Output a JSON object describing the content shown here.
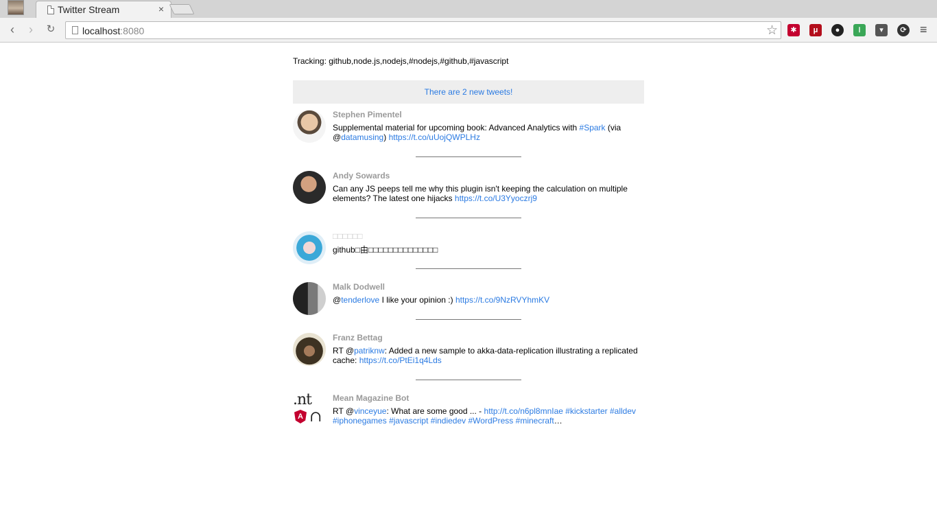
{
  "browser": {
    "tab_title": "Twitter Stream",
    "tab_close": "×",
    "url_host": "localhost",
    "url_port": ":8080",
    "nav": {
      "back": "‹",
      "forward": "›",
      "reload": "↻"
    },
    "star": "☆",
    "menu": "≡",
    "extensions": [
      {
        "name": "lastpass-icon",
        "glyph": "✱",
        "color": "#c3002f"
      },
      {
        "name": "utorrent-icon",
        "glyph": "μ",
        "color": "#b30e1c"
      },
      {
        "name": "github-icon",
        "glyph": "●",
        "color": "#222222"
      },
      {
        "name": "pushbullet-icon",
        "glyph": "⏽",
        "color": "#3aa757"
      },
      {
        "name": "pocket-icon",
        "glyph": "▾",
        "color": "#555555"
      },
      {
        "name": "sync-icon",
        "glyph": "⟳",
        "color": "#333333"
      }
    ]
  },
  "page": {
    "tracking": "Tracking: github,node.js,nodejs,#nodejs,#github,#javascript",
    "new_tweets": "There are 2 new tweets!",
    "tweets": [
      {
        "name": "Stephen Pimentel",
        "segments": [
          {
            "t": "Supplemental material for upcoming book: Advanced Analytics with "
          },
          {
            "t": "#Spark",
            "link": true
          },
          {
            "t": " (via @"
          },
          {
            "t": "datamusing",
            "link": true
          },
          {
            "t": ") "
          },
          {
            "t": "https://t.co/uUojQWPLHz",
            "link": true
          }
        ]
      },
      {
        "name": "Andy Sowards",
        "segments": [
          {
            "t": "Can any JS peeps tell me why this plugin isn't keeping the calculation on multiple elements? The latest one hijacks "
          },
          {
            "t": "https://t.co/U3Yyoczrj9",
            "link": true
          }
        ]
      },
      {
        "name": "□□□□□□",
        "segments": [
          {
            "t": "github□由□□□□□□□□□□□□□□"
          }
        ]
      },
      {
        "name": "Malk Dodwell",
        "segments": [
          {
            "t": "@"
          },
          {
            "t": "tenderlove",
            "link": true
          },
          {
            "t": " I like your opinion :) "
          },
          {
            "t": "https://t.co/9NzRVYhmKV",
            "link": true
          }
        ]
      },
      {
        "name": "Franz Bettag",
        "segments": [
          {
            "t": "RT @"
          },
          {
            "t": "patriknw",
            "link": true
          },
          {
            "t": ": Added a new sample to akka-data-replication illustrating a replicated cache: "
          },
          {
            "t": "https://t.co/PtEi1q4Lds",
            "link": true
          }
        ]
      },
      {
        "name": "Mean Magazine Bot",
        "segments": [
          {
            "t": "RT @"
          },
          {
            "t": "vinceyue",
            "link": true
          },
          {
            "t": ": What are some good ... - "
          },
          {
            "t": "http://t.co/n6pl8mnIae",
            "link": true
          },
          {
            "t": " "
          },
          {
            "t": "#kickstarter",
            "link": true
          },
          {
            "t": " "
          },
          {
            "t": "#alldev",
            "link": true
          },
          {
            "t": " "
          },
          {
            "t": "#iphonegames",
            "link": true
          },
          {
            "t": " "
          },
          {
            "t": "#javascript",
            "link": true
          },
          {
            "t": " "
          },
          {
            "t": "#indiedev",
            "link": true
          },
          {
            "t": " "
          },
          {
            "t": "#WordPress",
            "link": true
          },
          {
            "t": " "
          },
          {
            "t": "#minecraft",
            "link": true
          },
          {
            "t": "…"
          }
        ]
      }
    ]
  }
}
